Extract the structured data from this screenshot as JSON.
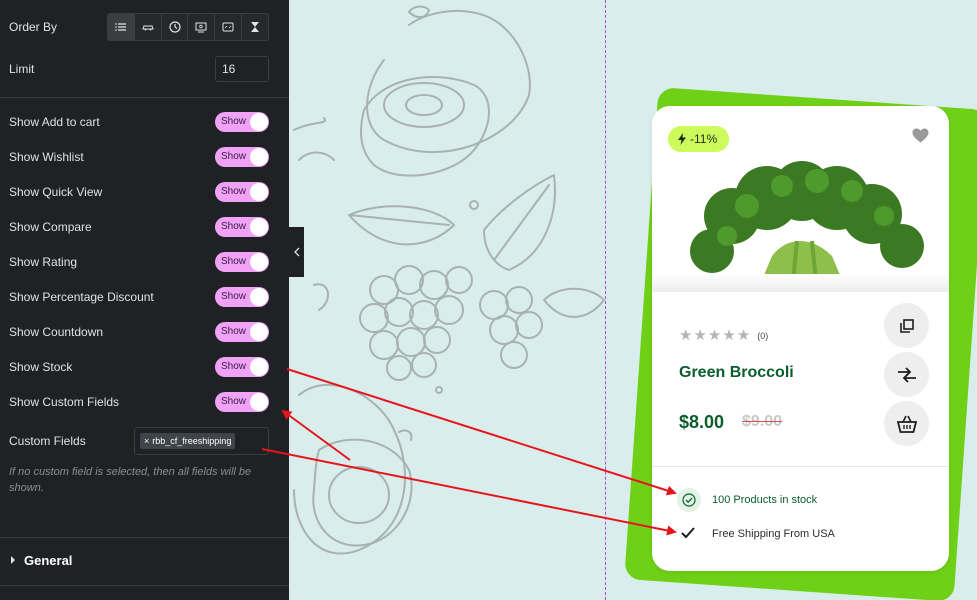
{
  "panel": {
    "order_by_label": "Order By",
    "order_by_options": [
      {
        "icon": "list-icon",
        "active": true
      },
      {
        "icon": "car-icon",
        "active": false
      },
      {
        "icon": "clock-icon",
        "active": false
      },
      {
        "icon": "money-icon",
        "active": false
      },
      {
        "icon": "sale-tag-icon",
        "active": false
      },
      {
        "icon": "hourglass-icon",
        "active": false
      }
    ],
    "limit_label": "Limit",
    "limit_value": "16",
    "toggles": [
      {
        "label": "Show Add to cart",
        "state": "Show"
      },
      {
        "label": "Show Wishlist",
        "state": "Show"
      },
      {
        "label": "Show Quick View",
        "state": "Show"
      },
      {
        "label": "Show Compare",
        "state": "Show"
      },
      {
        "label": "Show Rating",
        "state": "Show"
      },
      {
        "label": "Show Percentage Discount",
        "state": "Show"
      },
      {
        "label": "Show Countdown",
        "state": "Show"
      },
      {
        "label": "Show Stock",
        "state": "Show"
      },
      {
        "label": "Show Custom Fields",
        "state": "Show"
      }
    ],
    "custom_fields_label": "Custom Fields",
    "custom_fields_chip": "rbb_cf_freeshipping",
    "custom_fields_remove": "×",
    "custom_fields_help": "If no custom field is selected, then all fields will be shown.",
    "general_section": "General"
  },
  "card": {
    "discount": "-11%",
    "rating_count": "(0)",
    "rating_stars": 0,
    "title": "Green Broccoli",
    "price_current": "$8.00",
    "price_old": "$9.00",
    "stock_text": "100 Products in stock",
    "shipping_text": "Free Shipping From USA"
  },
  "colors": {
    "panel_bg": "#1f2124",
    "toggle_on": "#f0a2f6",
    "canvas_bg": "#d9eeec",
    "card_accent": "#6fd117",
    "badge_bg": "#ccfb5b",
    "brand_green": "#0b5d2b",
    "arrow": "#e8141b"
  }
}
